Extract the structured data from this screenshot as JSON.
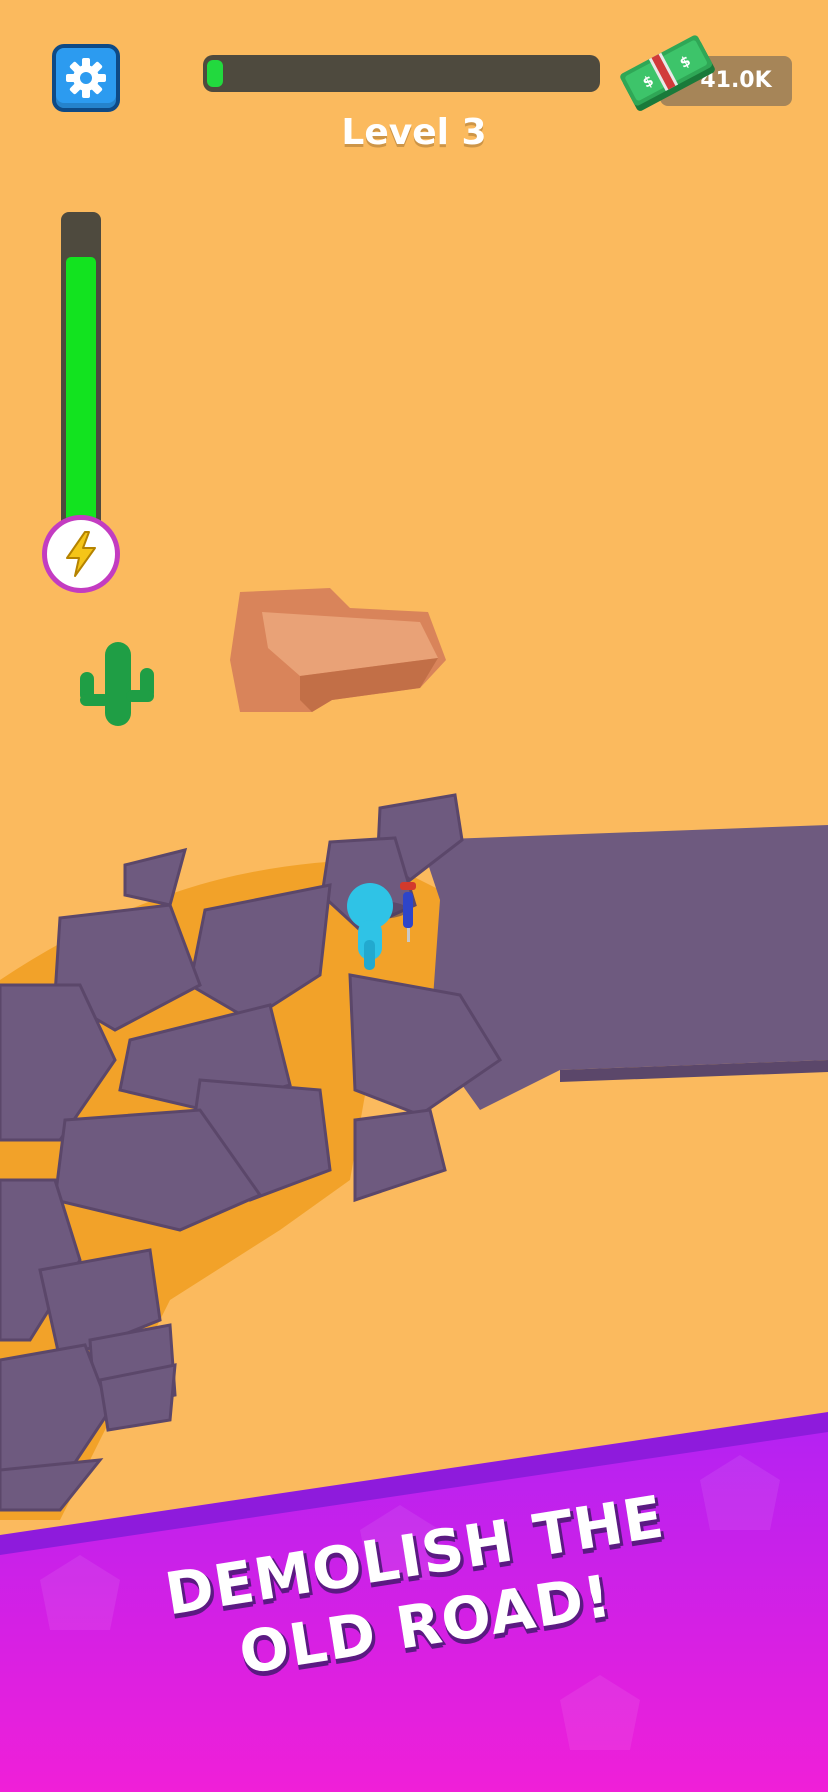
{
  "hud": {
    "level_label": "Level 3",
    "level_progress": 0.04,
    "money_value": "41.0K",
    "energy_level": 0.87
  },
  "banner": {
    "line1": "DEMOLISH THE",
    "line2": "OLD ROAD!"
  },
  "icons": {
    "settings": "gear-icon",
    "energy": "lightning-icon",
    "money": "cash-stack-icon"
  },
  "colors": {
    "sand": "#FBBA5E",
    "road": "#6E5A7F",
    "road_crack": "#F2A229",
    "energy_fill": "#12E31F",
    "settings_button": "#2C9BF0",
    "banner_top": "#A11BF0",
    "banner_bottom": "#F01FD8"
  }
}
